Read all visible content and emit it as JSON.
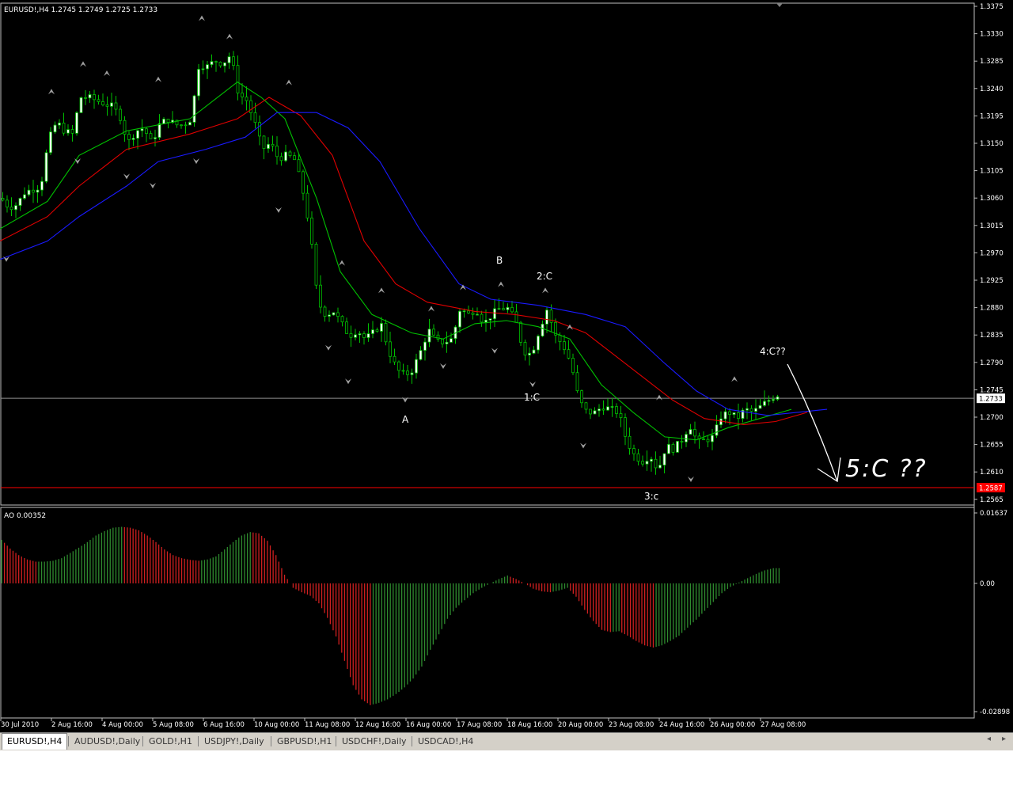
{
  "chart_header": "EURUSD!,H4  1.2745 1.2749 1.2725 1.2733",
  "indicator_header": "AO 0.00352",
  "price_axis": {
    "labels": [
      "1.3375",
      "1.3330",
      "1.3285",
      "1.3240",
      "1.3195",
      "1.3150",
      "1.3105",
      "1.3060",
      "1.3015",
      "1.2970",
      "1.2925",
      "1.2880",
      "1.2835",
      "1.2790",
      "1.2745",
      "1.2700",
      "1.2655",
      "1.2610",
      "1.2565"
    ],
    "current_price": "1.2733",
    "support_price": "1.2587"
  },
  "ao_axis": {
    "labels": [
      "0.01637",
      "0.00",
      "-0.02898"
    ]
  },
  "time_axis": [
    "30 Jul 2010",
    "2 Aug 16:00",
    "4 Aug 00:00",
    "5 Aug 08:00",
    "6 Aug 16:00",
    "10 Aug 00:00",
    "11 Aug 08:00",
    "12 Aug 16:00",
    "16 Aug 00:00",
    "17 Aug 08:00",
    "18 Aug 16:00",
    "20 Aug 00:00",
    "23 Aug 08:00",
    "24 Aug 16:00",
    "26 Aug 00:00",
    "27 Aug 08:00"
  ],
  "annotations": {
    "a": "A",
    "b": "B",
    "c1": "1:C",
    "c2": "2:C",
    "c3": "3:c",
    "c4": "4:C??",
    "c5": "5:C ??"
  },
  "tabs": [
    {
      "label": "EURUSD!,H4",
      "active": true
    },
    {
      "label": "AUDUSD!,Daily"
    },
    {
      "label": "GOLD!,H1"
    },
    {
      "label": "USDJPY!,Daily"
    },
    {
      "label": "GBPUSD!,H1"
    },
    {
      "label": "USDCHF!,Daily"
    },
    {
      "label": "USDCAD!,H4"
    }
  ],
  "colors": {
    "background": "#000000",
    "bull": "#ffffff",
    "bear": "#000000",
    "wick": "#00c000",
    "ma_green": "#00c000",
    "ma_red": "#e00000",
    "ma_blue": "#1a1aff",
    "ao_up": "#2e8b2e",
    "ao_down": "#d02020",
    "support_line": "#ff0000",
    "fractal": "#a0a0a0"
  },
  "chart_data": [
    {
      "type": "candlestick",
      "title": "EURUSD!,H4",
      "ylim": [
        1.2555,
        1.338
      ],
      "x_range": [
        "30 Jul 2010",
        "27 Aug 2010 16:00"
      ],
      "close_points": [
        [
          0,
          1.306
        ],
        [
          10,
          1.3045
        ],
        [
          20,
          1.305
        ],
        [
          30,
          1.307
        ],
        [
          40,
          1.3075
        ],
        [
          50,
          1.308
        ],
        [
          60,
          1.3155
        ],
        [
          70,
          1.3185
        ],
        [
          80,
          1.317
        ],
        [
          90,
          1.3165
        ],
        [
          100,
          1.3225
        ],
        [
          110,
          1.3225
        ],
        [
          120,
          1.322
        ],
        [
          130,
          1.3215
        ],
        [
          140,
          1.321
        ],
        [
          150,
          1.3195
        ],
        [
          160,
          1.315
        ],
        [
          170,
          1.317
        ],
        [
          180,
          1.3175
        ],
        [
          190,
          1.315
        ],
        [
          200,
          1.318
        ],
        [
          210,
          1.319
        ],
        [
          220,
          1.318
        ],
        [
          230,
          1.318
        ],
        [
          240,
          1.319
        ],
        [
          250,
          1.328
        ],
        [
          260,
          1.3275
        ],
        [
          270,
          1.3285
        ],
        [
          280,
          1.328
        ],
        [
          290,
          1.3295
        ],
        [
          300,
          1.323
        ],
        [
          310,
          1.322
        ],
        [
          320,
          1.3185
        ],
        [
          330,
          1.314
        ],
        [
          340,
          1.315
        ],
        [
          350,
          1.3125
        ],
        [
          360,
          1.313
        ],
        [
          370,
          1.3125
        ],
        [
          380,
          1.308
        ],
        [
          390,
          1.301
        ],
        [
          400,
          1.289
        ],
        [
          410,
          1.287
        ],
        [
          420,
          1.2875
        ],
        [
          430,
          1.2855
        ],
        [
          440,
          1.2835
        ],
        [
          450,
          1.2845
        ],
        [
          460,
          1.283
        ],
        [
          470,
          1.284
        ],
        [
          480,
          1.2855
        ],
        [
          490,
          1.281
        ],
        [
          500,
          1.278
        ],
        [
          510,
          1.277
        ],
        [
          520,
          1.278
        ],
        [
          530,
          1.281
        ],
        [
          540,
          1.2845
        ],
        [
          550,
          1.2825
        ],
        [
          560,
          1.2825
        ],
        [
          570,
          1.283
        ],
        [
          580,
          1.288
        ],
        [
          590,
          1.287
        ],
        [
          600,
          1.288
        ],
        [
          610,
          1.2855
        ],
        [
          620,
          1.287
        ],
        [
          630,
          1.288
        ],
        [
          640,
          1.288
        ],
        [
          650,
          1.286
        ],
        [
          660,
          1.281
        ],
        [
          670,
          1.2805
        ],
        [
          680,
          1.2845
        ],
        [
          690,
          1.288
        ],
        [
          700,
          1.2835
        ],
        [
          710,
          1.282
        ],
        [
          720,
          1.279
        ],
        [
          730,
          1.273
        ],
        [
          740,
          1.271
        ],
        [
          750,
          1.271
        ],
        [
          760,
          1.272
        ],
        [
          770,
          1.2715
        ],
        [
          780,
          1.271
        ],
        [
          790,
          1.2665
        ],
        [
          800,
          1.264
        ],
        [
          810,
          1.263
        ],
        [
          820,
          1.264
        ],
        [
          830,
          1.2615
        ],
        [
          840,
          1.2655
        ],
        [
          850,
          1.265
        ],
        [
          860,
          1.2665
        ],
        [
          870,
          1.269
        ],
        [
          880,
          1.266
        ],
        [
          890,
          1.2665
        ],
        [
          900,
          1.267
        ],
        [
          910,
          1.2705
        ],
        [
          920,
          1.271
        ],
        [
          930,
          1.27
        ],
        [
          940,
          1.2715
        ],
        [
          950,
          1.271
        ],
        [
          960,
          1.272
        ],
        [
          970,
          1.273
        ],
        [
          980,
          1.274
        ],
        [
          985,
          1.2733
        ]
      ],
      "moving_averages": {
        "green": [
          [
            0,
            1.301
          ],
          [
            60,
            1.3055
          ],
          [
            100,
            1.313
          ],
          [
            160,
            1.317
          ],
          [
            240,
            1.319
          ],
          [
            300,
            1.325
          ],
          [
            330,
            1.3225
          ],
          [
            360,
            1.319
          ],
          [
            400,
            1.306
          ],
          [
            430,
            1.294
          ],
          [
            470,
            1.287
          ],
          [
            520,
            1.284
          ],
          [
            560,
            1.283
          ],
          [
            600,
            1.2855
          ],
          [
            640,
            1.286
          ],
          [
            680,
            1.285
          ],
          [
            720,
            1.283
          ],
          [
            760,
            1.2755
          ],
          [
            800,
            1.271
          ],
          [
            840,
            1.267
          ],
          [
            880,
            1.2665
          ],
          [
            920,
            1.2685
          ],
          [
            960,
            1.27
          ],
          [
            1000,
            1.2715
          ]
        ],
        "red": [
          [
            0,
            1.299
          ],
          [
            60,
            1.303
          ],
          [
            100,
            1.308
          ],
          [
            160,
            1.314
          ],
          [
            240,
            1.3165
          ],
          [
            300,
            1.319
          ],
          [
            340,
            1.3225
          ],
          [
            380,
            1.3195
          ],
          [
            420,
            1.313
          ],
          [
            460,
            1.299
          ],
          [
            500,
            1.292
          ],
          [
            540,
            1.289
          ],
          [
            600,
            1.2875
          ],
          [
            650,
            1.287
          ],
          [
            700,
            1.286
          ],
          [
            740,
            1.284
          ],
          [
            800,
            1.278
          ],
          [
            850,
            1.273
          ],
          [
            890,
            1.27
          ],
          [
            940,
            1.269
          ],
          [
            980,
            1.2695
          ],
          [
            1020,
            1.271
          ]
        ],
        "blue": [
          [
            0,
            1.296
          ],
          [
            60,
            1.299
          ],
          [
            100,
            1.303
          ],
          [
            160,
            1.308
          ],
          [
            200,
            1.312
          ],
          [
            260,
            1.314
          ],
          [
            310,
            1.316
          ],
          [
            350,
            1.32
          ],
          [
            400,
            1.32
          ],
          [
            440,
            1.3175
          ],
          [
            480,
            1.312
          ],
          [
            530,
            1.301
          ],
          [
            580,
            1.292
          ],
          [
            620,
            1.2895
          ],
          [
            680,
            1.2885
          ],
          [
            740,
            1.287
          ],
          [
            790,
            1.285
          ],
          [
            840,
            1.279
          ],
          [
            880,
            1.2745
          ],
          [
            920,
            1.2715
          ],
          [
            970,
            1.2705
          ],
          [
            1045,
            1.2715
          ]
        ]
      },
      "fractals": {
        "up": [
          [
            65,
            1.3235
          ],
          [
            105,
            1.328
          ],
          [
            135,
            1.3265
          ],
          [
            200,
            1.3255
          ],
          [
            255,
            1.3355
          ],
          [
            290,
            1.3325
          ],
          [
            365,
            1.325
          ],
          [
            432,
            1.2955
          ],
          [
            482,
            1.291
          ],
          [
            545,
            1.288
          ],
          [
            585,
            1.2915
          ],
          [
            633,
            1.292
          ],
          [
            689,
            1.291
          ],
          [
            720,
            1.285
          ],
          [
            833,
            1.2735
          ],
          [
            928,
            1.2765
          ]
        ],
        "down": [
          [
            8,
            1.296
          ],
          [
            98,
            1.312
          ],
          [
            160,
            1.3095
          ],
          [
            193,
            1.308
          ],
          [
            248,
            1.312
          ],
          [
            352,
            1.304
          ],
          [
            415,
            1.2815
          ],
          [
            440,
            1.276
          ],
          [
            512,
            1.273
          ],
          [
            560,
            1.2785
          ],
          [
            625,
            1.281
          ],
          [
            673,
            1.2755
          ],
          [
            737,
            1.2655
          ],
          [
            873,
            1.26
          ]
        ]
      },
      "horizontal_lines": [
        {
          "price": 1.2733,
          "label": "current"
        },
        {
          "price": 1.2587,
          "label": "support"
        }
      ]
    },
    {
      "type": "bar",
      "title": "AO 0.00352",
      "ylim": [
        -0.02898,
        0.01637
      ],
      "values": [
        0.01,
        0.008,
        0.0065,
        0.0055,
        0.005,
        0.005,
        0.0052,
        0.0058,
        0.007,
        0.0082,
        0.0095,
        0.011,
        0.012,
        0.0128,
        0.013,
        0.0128,
        0.0122,
        0.011,
        0.0095,
        0.0078,
        0.0065,
        0.0058,
        0.0054,
        0.0052,
        0.0055,
        0.0062,
        0.0078,
        0.0095,
        0.011,
        0.0118,
        0.0115,
        0.0098,
        0.0065,
        0.002,
        -0.001,
        -0.002,
        -0.0028,
        -0.0045,
        -0.0078,
        -0.012,
        -0.0175,
        -0.023,
        -0.0262,
        -0.0275,
        -0.027,
        -0.0262,
        -0.025,
        -0.0235,
        -0.0215,
        -0.0188,
        -0.015,
        -0.0115,
        -0.008,
        -0.0055,
        -0.0038,
        -0.0022,
        -0.001,
        0.0,
        0.001,
        0.0018,
        0.001,
        0.0,
        -0.0012,
        -0.0018,
        -0.002,
        -0.0016,
        -0.001,
        -0.003,
        -0.006,
        -0.0085,
        -0.0105,
        -0.011,
        -0.0108,
        -0.0118,
        -0.013,
        -0.014,
        -0.0145,
        -0.014,
        -0.013,
        -0.0118,
        -0.01,
        -0.0082,
        -0.0062,
        -0.0042,
        -0.0022,
        -0.0008,
        0.0002,
        0.0012,
        0.0022,
        0.003,
        0.0035
      ],
      "bar_colors_rule": "green when value increases vs previous bar, red when it decreases"
    }
  ]
}
